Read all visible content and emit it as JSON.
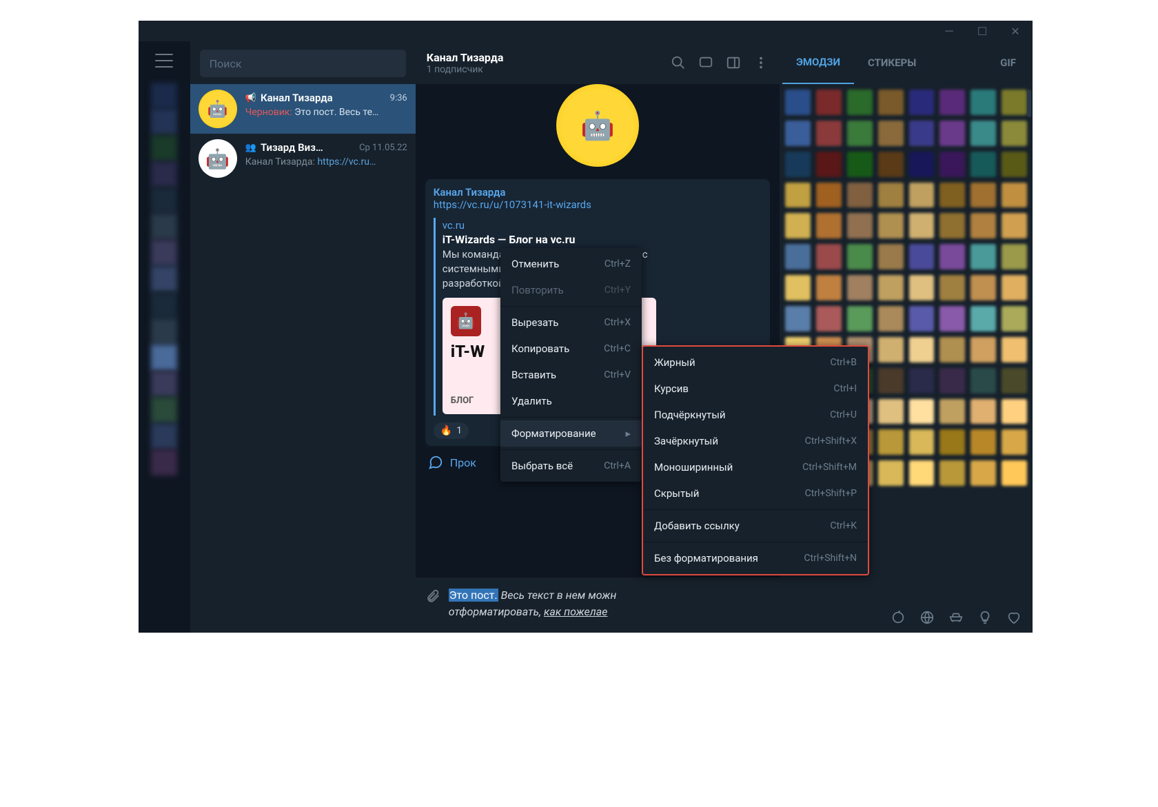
{
  "search_placeholder": "Поиск",
  "chats": [
    {
      "name": "Канал Тизарда",
      "time": "9:36",
      "draft_label": "Черновик:",
      "preview": "Это пост. Весь те…"
    },
    {
      "name": "Тизард Виз…",
      "time": "Ср 11.05.22",
      "from": "Канал Тизарда:",
      "preview": "https://vc.ru…"
    }
  ],
  "header": {
    "title": "Канал Тизарда",
    "subtitle": "1 подписчик"
  },
  "message": {
    "channel": "Канал Тизарда",
    "url": "https://vc.ru/u/1073141-it-wizards",
    "card": {
      "domain": "vc.ru",
      "title": "iT-Wizards — Блог на vc.ru",
      "desc1": "Мы команда IT-Волшебников! Помогаем с",
      "desc2": "системными администрированием, веб-",
      "desc3": "разработкой                                                       кетингом, s…"
    },
    "thumb": {
      "title": "iT-W",
      "blog": "блог"
    },
    "reaction_count": "1",
    "comment_label": "Прок"
  },
  "compose": {
    "selected": "Это пост.",
    "rest1": " Весь текст в нем можн",
    "rest2": "отформатировать, ",
    "underlined": "как пожелае"
  },
  "ctx1": [
    {
      "label": "Отменить",
      "sc": "Ctrl+Z"
    },
    {
      "label": "Повторить",
      "sc": "Ctrl+Y",
      "disabled": true
    },
    {
      "sep": true
    },
    {
      "label": "Вырезать",
      "sc": "Ctrl+X"
    },
    {
      "label": "Копировать",
      "sc": "Ctrl+C"
    },
    {
      "label": "Вставить",
      "sc": "Ctrl+V"
    },
    {
      "label": "Удалить",
      "sc": ""
    },
    {
      "sep": true
    },
    {
      "label": "Форматирование",
      "sc": "",
      "hl": true,
      "sub": true
    },
    {
      "sep": true
    },
    {
      "label": "Выбрать всё",
      "sc": "Ctrl+A"
    }
  ],
  "ctx2": [
    {
      "label": "Жирный",
      "sc": "Ctrl+B"
    },
    {
      "label": "Курсив",
      "sc": "Ctrl+I"
    },
    {
      "label": "Подчёркнутый",
      "sc": "Ctrl+U"
    },
    {
      "label": "Зачёркнутый",
      "sc": "Ctrl+Shift+X"
    },
    {
      "label": "Моноширинный",
      "sc": "Ctrl+Shift+M"
    },
    {
      "label": "Скрытый",
      "sc": "Ctrl+Shift+P"
    },
    {
      "sep": true
    },
    {
      "label": "Добавить ссылку",
      "sc": "Ctrl+K"
    },
    {
      "sep": true
    },
    {
      "label": "Без форматирования",
      "sc": "Ctrl+Shift+N"
    }
  ],
  "panel": {
    "tabs": [
      "ЭМОДЗИ",
      "СТИКЕРЫ",
      "GIF"
    ]
  },
  "swatch_colors": [
    "#2a4e8a",
    "#7a2a2a",
    "#2a6a2a",
    "#7a5a2a",
    "#2a2a7a",
    "#5a2a7a",
    "#2a7a7a",
    "#7a7a2a",
    "#3a5e9a",
    "#8a3a3a",
    "#3a7a3a",
    "#8a6a3a",
    "#3a3a8a",
    "#6a3a8a",
    "#3a8a8a",
    "#8a8a3a",
    "#173a5a",
    "#5a1717",
    "#175a17",
    "#5a3a17",
    "#17175a",
    "#3a175a",
    "#175a5a",
    "#5a5a17",
    "#c0a040",
    "#a06020",
    "#806040",
    "#a08040",
    "#c0a060",
    "#806020",
    "#a07030",
    "#c09040",
    "#d0b050",
    "#b07030",
    "#907050",
    "#b09050",
    "#d0b070",
    "#907030",
    "#b08040",
    "#d0a050",
    "#4a6e9a",
    "#9a4a4a",
    "#4a8a4a",
    "#9a7a4a",
    "#4a4a9a",
    "#7a4a9a",
    "#4a9a9a",
    "#9a9a4a",
    "#e0c060",
    "#c08040",
    "#a08060",
    "#c0a060",
    "#e0c080",
    "#a08040",
    "#c09050",
    "#e0b060",
    "#5a7eaa",
    "#aa5a5a",
    "#5a9a5a",
    "#aa8a5a",
    "#5a5aaa",
    "#8a5aaa",
    "#5aaaaa",
    "#aaaa5a",
    "#f0d070",
    "#d09050",
    "#b09070",
    "#d0b070",
    "#f0d090",
    "#b09050",
    "#d0a060",
    "#f0c070",
    "#2a3a4a",
    "#4a2a2a",
    "#2a4a2a",
    "#4a3a2a",
    "#2a2a4a",
    "#3a2a4a",
    "#2a4a4a",
    "#4a4a2a",
    "#ffe080",
    "#e0a060",
    "#c0a080",
    "#e0c080",
    "#ffe0a0",
    "#c0a060",
    "#e0b070",
    "#ffd080",
    "#c89838",
    "#a87818",
    "#987838",
    "#b89838",
    "#d8b858",
    "#987818",
    "#b88828",
    "#d8a848",
    "#ffd858",
    "#d89838",
    "#b89858",
    "#d8b858",
    "#ffd878",
    "#b89838",
    "#d8a848",
    "#ffc858"
  ],
  "rail_colors": [
    "#1a2a4a",
    "#223355",
    "#1a3a2a",
    "#2a2a4a",
    "#1a2a3a",
    "#2a3a4a",
    "#3a3a5a",
    "#334466",
    "#1a2a3a",
    "#2a3a4a",
    "#4a6a9a",
    "#3a3a5a",
    "#2a4a3a",
    "#2a3a5a",
    "#3a2a4a"
  ]
}
